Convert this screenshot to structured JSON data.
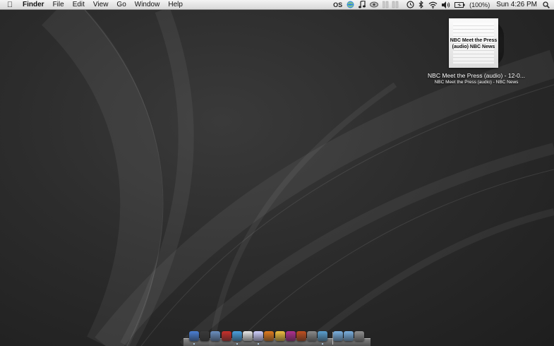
{
  "menubar": {
    "apple_icon": "apple-logo-icon",
    "app_name": "Finder",
    "menus": [
      "File",
      "Edit",
      "View",
      "Go",
      "Window",
      "Help"
    ],
    "status_items": {
      "os_label": "OS",
      "battery_text": "(100%)",
      "clock": "Sun 4:26 PM"
    },
    "status_icons": [
      "os-icon",
      "globe-icon",
      "music-note-icon",
      "eye-icon",
      "cpu-meter-icon",
      "time-machine-icon",
      "bluetooth-icon",
      "wifi-icon",
      "volume-icon",
      "battery-icon",
      "spotlight-icon"
    ]
  },
  "desktop": {
    "document": {
      "art_text": "NBC Meet the Press (audio) NBC News",
      "title": "NBC Meet the Press (audio) - 12-0...",
      "subtitle": "NBC Meet the Press (audio) - NBC News"
    }
  },
  "dock": {
    "items": [
      {
        "name": "finder-icon",
        "color": "#4a7fd4",
        "running": true
      },
      {
        "name": "dashboard-icon",
        "color": "#3a3a3a",
        "running": false
      },
      {
        "name": "mail-stamp-icon",
        "color": "#6a8fc0",
        "running": false
      },
      {
        "name": "gmail-icon",
        "color": "#c9302c",
        "running": false
      },
      {
        "name": "safari-icon",
        "color": "#4aa0e0",
        "running": true
      },
      {
        "name": "ical-icon",
        "color": "#e8e8e8",
        "running": false
      },
      {
        "name": "itunes-icon",
        "color": "#d0d0ff",
        "running": true
      },
      {
        "name": "firefox-icon",
        "color": "#e07b20",
        "running": false
      },
      {
        "name": "notes-icon",
        "color": "#f0c040",
        "running": false
      },
      {
        "name": "textmate-icon",
        "color": "#b03090",
        "running": false
      },
      {
        "name": "photo-booth-icon",
        "color": "#c05020",
        "running": false
      },
      {
        "name": "system-preferences-icon",
        "color": "#8a8a8a",
        "running": false
      },
      {
        "name": "network-globe-icon",
        "color": "#5aa0d0",
        "running": true
      },
      {
        "name": "applications-folder-icon",
        "color": "#7ab0e0",
        "running": false
      },
      {
        "name": "documents-folder-icon",
        "color": "#7ab0e0",
        "running": false
      },
      {
        "name": "trash-icon",
        "color": "#909090",
        "running": false
      }
    ]
  }
}
